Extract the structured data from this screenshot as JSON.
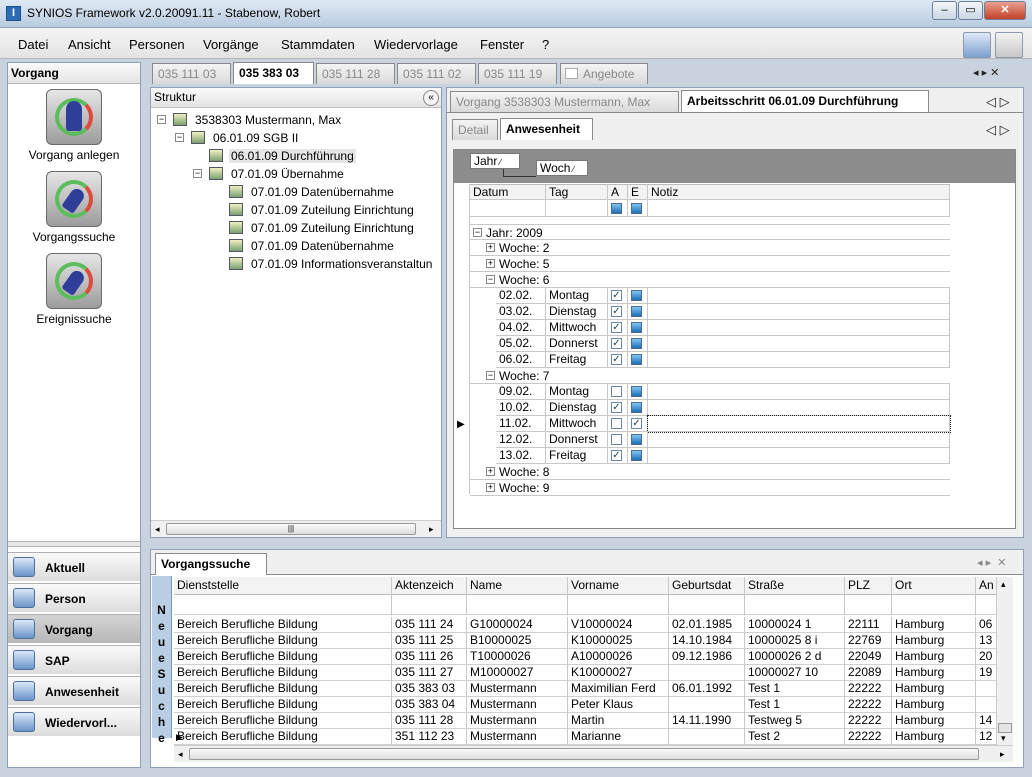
{
  "window": {
    "title": "SYNIOS Framework v2.0.20091.11 - Stabenow, Robert",
    "controls": {
      "minimize": "–",
      "maximize": "▭",
      "close": "✕"
    }
  },
  "menu": [
    "Datei",
    "Ansicht",
    "Personen",
    "Vorgänge",
    "Stammdaten",
    "Wiedervorlage",
    "Fenster",
    "?"
  ],
  "left_panel": {
    "header": "Vorgang",
    "actions": [
      {
        "label": "Vorgang anlegen",
        "icon": "person-add-icon"
      },
      {
        "label": "Vorgangssuche",
        "icon": "search-icon"
      },
      {
        "label": "Ereignissuche",
        "icon": "event-search-icon"
      }
    ],
    "nav": [
      {
        "label": "Aktuell",
        "icon": "current-icon"
      },
      {
        "label": "Person",
        "icon": "person-icon"
      },
      {
        "label": "Vorgang",
        "icon": "vorgang-icon",
        "selected": true
      },
      {
        "label": "SAP",
        "icon": "sap-icon"
      },
      {
        "label": "Anwesenheit",
        "icon": "attendance-icon"
      },
      {
        "label": "Wiedervorl...",
        "icon": "resubmission-icon"
      }
    ]
  },
  "doc_tabs": [
    {
      "label": "035 111 03",
      "active": false
    },
    {
      "label": "035 383 03",
      "active": true
    },
    {
      "label": "035 111 28",
      "active": false
    },
    {
      "label": "035 111 02",
      "active": false
    },
    {
      "label": "035 111 19",
      "active": false
    },
    {
      "label": "Angebote",
      "active": false
    }
  ],
  "struktur": {
    "header": "Struktur",
    "nodes": [
      {
        "label": "3538303 Mustermann, Max",
        "level": 0,
        "expander": "−"
      },
      {
        "label": "06.01.09 SGB II",
        "level": 1,
        "expander": "−"
      },
      {
        "label": "06.01.09 Durchführung",
        "level": 2,
        "expander": "",
        "selected": true
      },
      {
        "label": "07.01.09 Übernahme",
        "level": 2,
        "expander": "−"
      },
      {
        "label": "07.01.09 Datenübernahme",
        "level": 3,
        "expander": ""
      },
      {
        "label": "07.01.09 Zuteilung Einrichtung",
        "level": 3,
        "expander": ""
      },
      {
        "label": "07.01.09 Zuteilung Einrichtung",
        "level": 3,
        "expander": ""
      },
      {
        "label": "07.01.09 Datenübernahme",
        "level": 3,
        "expander": ""
      },
      {
        "label": "07.01.09 Informationsveranstaltun",
        "level": 3,
        "expander": ""
      }
    ],
    "scroll_grip": "|||"
  },
  "detail": {
    "tabs": [
      {
        "label": "Vorgang 3538303 Mustermann, Max",
        "active": false
      },
      {
        "label": "Arbeitsschritt 06.01.09 Durchführung",
        "active": true
      }
    ],
    "subtabs": [
      {
        "label": "Detail",
        "active": false
      },
      {
        "label": "Anwesenheit",
        "active": true
      }
    ],
    "group_by": [
      "Jahr",
      "Woch"
    ],
    "columns": [
      "Datum",
      "Tag",
      "A",
      "E",
      "Notiz"
    ],
    "year_label": "Jahr: 2009",
    "rows": [
      {
        "kind": "week",
        "label": "Woche: 2",
        "exp": "+"
      },
      {
        "kind": "week",
        "label": "Woche: 5",
        "exp": "+"
      },
      {
        "kind": "week",
        "label": "Woche: 6",
        "exp": "−"
      },
      {
        "kind": "day",
        "date": "02.02.",
        "day": "Montag",
        "a": true,
        "e": true
      },
      {
        "kind": "day",
        "date": "03.02.",
        "day": "Dienstag",
        "a": true,
        "e": true
      },
      {
        "kind": "day",
        "date": "04.02.",
        "day": "Mittwoch",
        "a": true,
        "e": true
      },
      {
        "kind": "day",
        "date": "05.02.",
        "day": "Donnerst",
        "a": true,
        "e": true
      },
      {
        "kind": "day",
        "date": "06.02.",
        "day": "Freitag",
        "a": true,
        "e": true
      },
      {
        "kind": "week",
        "label": "Woche: 7",
        "exp": "−"
      },
      {
        "kind": "day",
        "date": "09.02.",
        "day": "Montag",
        "a": false,
        "e": true
      },
      {
        "kind": "day",
        "date": "10.02.",
        "day": "Dienstag",
        "a": true,
        "e": true
      },
      {
        "kind": "day",
        "date": "11.02.",
        "day": "Mittwoch",
        "a": false,
        "e": true,
        "current": true
      },
      {
        "kind": "day",
        "date": "12.02.",
        "day": "Donnerst",
        "a": false,
        "e": true
      },
      {
        "kind": "day",
        "date": "13.02.",
        "day": "Freitag",
        "a": true,
        "e": true
      },
      {
        "kind": "week",
        "label": "Woche: 8",
        "exp": "+"
      },
      {
        "kind": "week",
        "label": "Woche: 9",
        "exp": "+"
      }
    ]
  },
  "search": {
    "tab": "Vorgangssuche",
    "side_button": "Neue Suche",
    "columns": [
      "Dienststelle",
      "Aktenzeich",
      "Name",
      "Vorname",
      "Geburtsdat",
      "Straße",
      "PLZ",
      "Ort",
      "An"
    ],
    "rows": [
      [
        "Bereich Berufliche Bildung",
        "035 111 24",
        "G10000024",
        "V10000024",
        "02.01.1985",
        "10000024 1",
        "22111",
        "Hamburg",
        "06"
      ],
      [
        "Bereich Berufliche Bildung",
        "035 111 25",
        "B10000025",
        "K10000025",
        "14.10.1984",
        "10000025 8 i",
        "22769",
        "Hamburg",
        "13"
      ],
      [
        "Bereich Berufliche Bildung",
        "035 111 26",
        "T10000026",
        "A10000026",
        "09.12.1986",
        "10000026 2 d",
        "22049",
        "Hamburg",
        "20"
      ],
      [
        "Bereich Berufliche Bildung",
        "035 111 27",
        "M10000027",
        "K10000027",
        "",
        "10000027 10",
        "22089",
        "Hamburg",
        "19"
      ],
      [
        "Bereich Berufliche Bildung",
        "035 383 03",
        "Mustermann",
        "Maximilian Ferd",
        "06.01.1992",
        "Test 1",
        "22222",
        "Hamburg",
        ""
      ],
      [
        "Bereich Berufliche Bildung",
        "035 383 04",
        "Mustermann",
        "Peter Klaus",
        "",
        "Test 1",
        "22222",
        "Hamburg",
        ""
      ],
      [
        "Bereich Berufliche Bildung",
        "035 111 28",
        "Mustermann",
        "Martin",
        "14.11.1990",
        "Testweg 5",
        "22222",
        "Hamburg",
        "14"
      ],
      [
        "Bereich Berufliche Bildung",
        "351 112 23",
        "Mustermann",
        "Marianne",
        "",
        "Test 2",
        "22222",
        "Hamburg",
        "12"
      ]
    ]
  }
}
